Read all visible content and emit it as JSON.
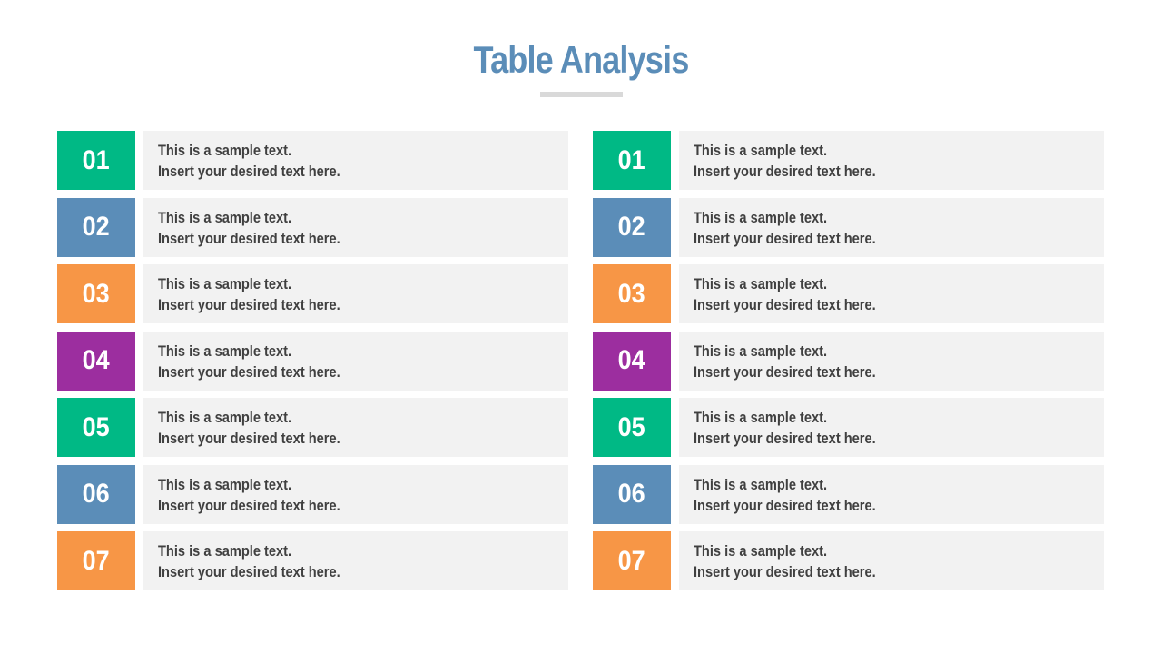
{
  "title": "Table Analysis",
  "colors": {
    "title": "#5b8db8",
    "green": "#00b985",
    "blue": "#5b8db8",
    "orange": "#f79646",
    "purple": "#9c2e9f"
  },
  "columns": [
    {
      "rows": [
        {
          "number": "01",
          "color": "#00b985",
          "line1": "This is a sample text.",
          "line2": "Insert your desired text here."
        },
        {
          "number": "02",
          "color": "#5b8db8",
          "line1": "This is a sample text.",
          "line2": "Insert your desired text here."
        },
        {
          "number": "03",
          "color": "#f79646",
          "line1": "This is a sample text.",
          "line2": "Insert your desired text here."
        },
        {
          "number": "04",
          "color": "#9c2e9f",
          "line1": "This is a sample text.",
          "line2": "Insert your desired text here."
        },
        {
          "number": "05",
          "color": "#00b985",
          "line1": "This is a sample text.",
          "line2": "Insert your desired text here."
        },
        {
          "number": "06",
          "color": "#5b8db8",
          "line1": "This is a sample text.",
          "line2": "Insert your desired text here."
        },
        {
          "number": "07",
          "color": "#f79646",
          "line1": "This is a sample text.",
          "line2": "Insert your desired text here."
        }
      ]
    },
    {
      "rows": [
        {
          "number": "01",
          "color": "#00b985",
          "line1": "This is a sample text.",
          "line2": "Insert your desired text here."
        },
        {
          "number": "02",
          "color": "#5b8db8",
          "line1": "This is a sample text.",
          "line2": "Insert your desired text here."
        },
        {
          "number": "03",
          "color": "#f79646",
          "line1": "This is a sample text.",
          "line2": "Insert your desired text here."
        },
        {
          "number": "04",
          "color": "#9c2e9f",
          "line1": "This is a sample text.",
          "line2": "Insert your desired text here."
        },
        {
          "number": "05",
          "color": "#00b985",
          "line1": "This is a sample text.",
          "line2": "Insert your desired text here."
        },
        {
          "number": "06",
          "color": "#5b8db8",
          "line1": "This is a sample text.",
          "line2": "Insert your desired text here."
        },
        {
          "number": "07",
          "color": "#f79646",
          "line1": "This is a sample text.",
          "line2": "Insert your desired text here."
        }
      ]
    }
  ]
}
